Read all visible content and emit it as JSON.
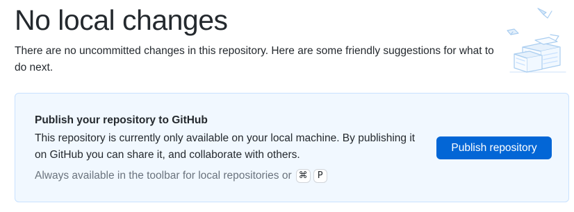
{
  "header": {
    "title": "No local changes",
    "subtitle": "There are no uncommitted changes in this repository. Here are some friendly suggestions for what to do next."
  },
  "publish_card": {
    "title": "Publish your repository to GitHub",
    "description": "This repository is currently only available on your local machine. By publishing it on GitHub you can share it, and collaborate with others.",
    "hint": "Always available in the toolbar for local repositories or",
    "shortcut_keys": [
      "⌘",
      "P"
    ],
    "button_label": "Publish repository"
  },
  "colors": {
    "accent": "#0366d6",
    "card_background": "#f1f8ff",
    "card_border": "#c8e1ff",
    "text_primary": "#24292e",
    "text_muted": "#6a737d"
  },
  "icons": {
    "illustration": "paper-stack-illustration"
  }
}
